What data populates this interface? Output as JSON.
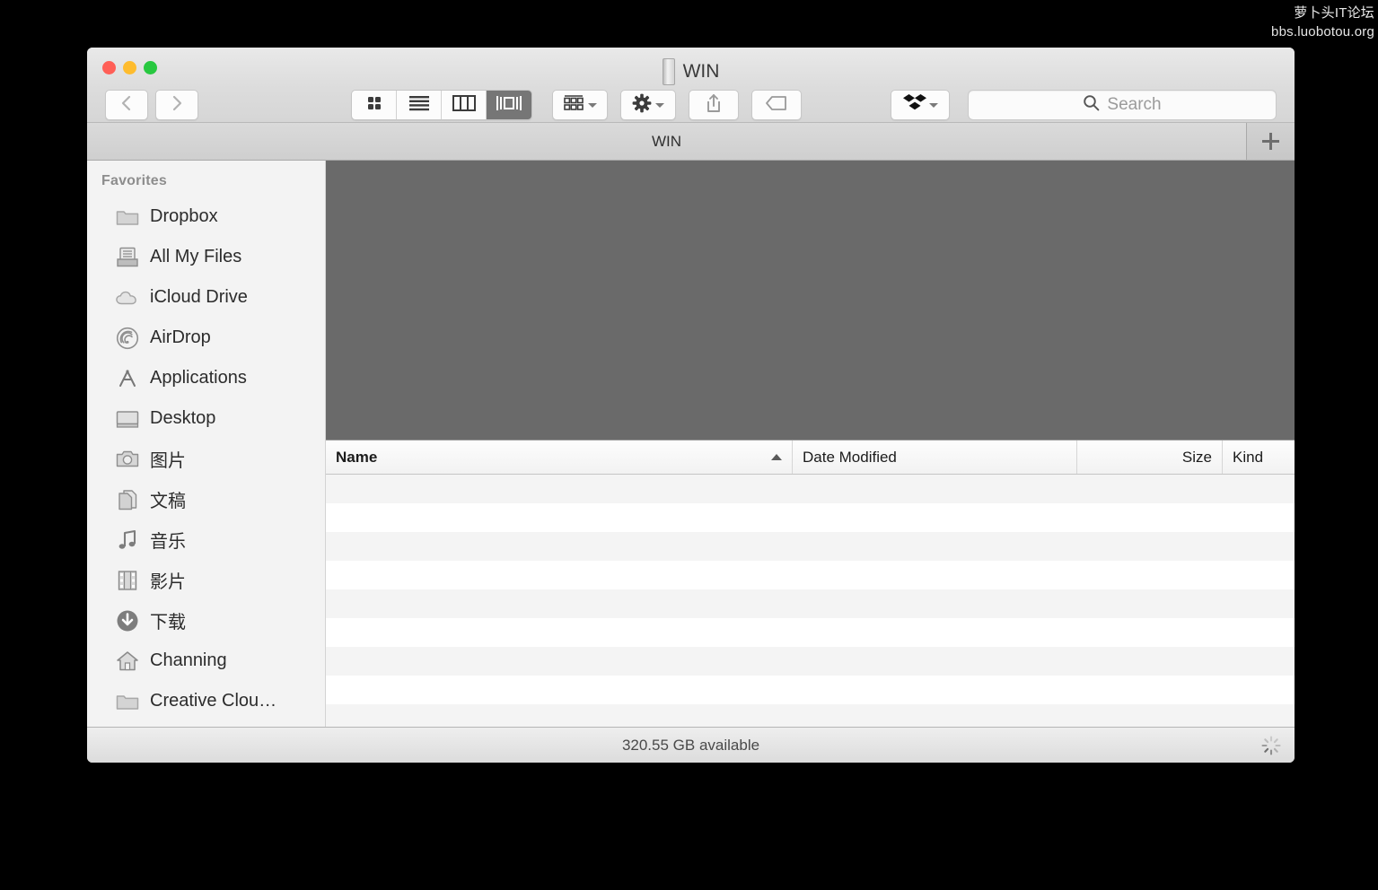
{
  "watermark": {
    "line1": "萝卜头IT论坛",
    "line2": "bbs.luobotou.org"
  },
  "window": {
    "title": "WIN",
    "title_icon": "hard-drive-icon",
    "traffic_lights": [
      {
        "name": "close",
        "color": "#ff5f57"
      },
      {
        "name": "minimize",
        "color": "#febc2e"
      },
      {
        "name": "zoom",
        "color": "#28c840"
      }
    ]
  },
  "toolbar": {
    "back_icon": "chevron-left-icon",
    "forward_icon": "chevron-right-icon",
    "view_modes": [
      {
        "name": "icon-view",
        "icon": "grid-icon",
        "active": false
      },
      {
        "name": "list-view",
        "icon": "list-icon",
        "active": false
      },
      {
        "name": "column-view",
        "icon": "columns-icon",
        "active": false
      },
      {
        "name": "coverflow-view",
        "icon": "coverflow-icon",
        "active": true
      }
    ],
    "arrange_icon": "arrange-grid-icon",
    "action_icon": "gear-icon",
    "share_icon": "share-icon",
    "tag_icon": "tag-icon",
    "dropbox_icon": "dropbox-icon"
  },
  "search": {
    "placeholder": "Search",
    "value": "",
    "icon": "search-icon"
  },
  "tabs": [
    {
      "label": "WIN",
      "active": true
    }
  ],
  "new_tab": {
    "icon": "plus-icon"
  },
  "sidebar": {
    "header": "Favorites",
    "items": [
      {
        "label": "Dropbox",
        "icon": "folder-icon"
      },
      {
        "label": "All My Files",
        "icon": "all-my-files-icon"
      },
      {
        "label": "iCloud Drive",
        "icon": "cloud-icon"
      },
      {
        "label": "AirDrop",
        "icon": "airdrop-icon"
      },
      {
        "label": "Applications",
        "icon": "applications-icon"
      },
      {
        "label": "Desktop",
        "icon": "desktop-icon"
      },
      {
        "label": "图片",
        "icon": "camera-icon"
      },
      {
        "label": "文稿",
        "icon": "documents-icon"
      },
      {
        "label": "音乐",
        "icon": "music-note-icon"
      },
      {
        "label": "影片",
        "icon": "film-icon"
      },
      {
        "label": "下载",
        "icon": "download-icon"
      },
      {
        "label": "Channing",
        "icon": "home-icon"
      },
      {
        "label": "Creative Clou…",
        "icon": "folder-icon"
      }
    ]
  },
  "columns": [
    {
      "label": "Name",
      "sort": "ascending"
    },
    {
      "label": "Date Modified",
      "sort": null
    },
    {
      "label": "Size",
      "sort": null
    },
    {
      "label": "Kind",
      "sort": null
    }
  ],
  "file_rows": [],
  "status": {
    "text": "320.55 GB available",
    "spinner_icon": "loading-spinner-icon",
    "busy": true
  },
  "colors": {
    "coverflow_bg": "#6a6a6a",
    "sidebar_bg": "#f3f3f3",
    "titlebar_bg": "#dcdcdc",
    "active_segment": "#767676"
  }
}
